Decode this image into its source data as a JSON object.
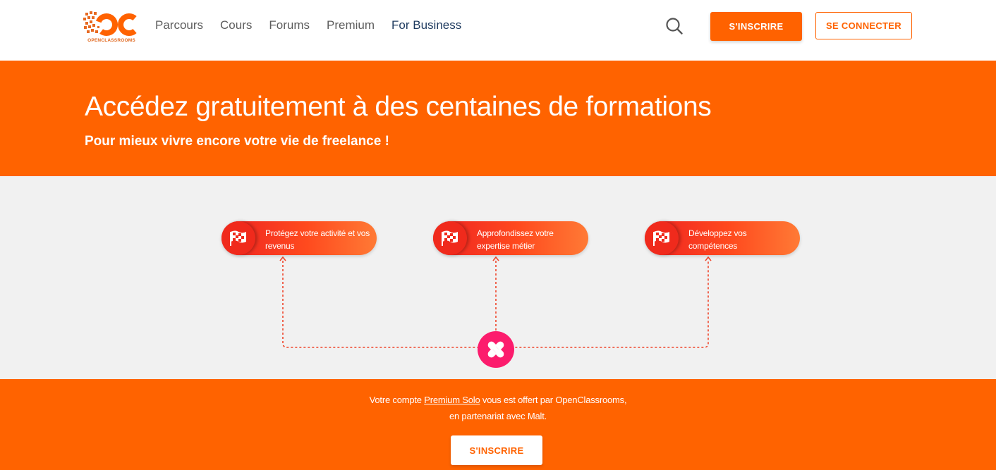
{
  "header": {
    "logo_text": "OPENCLASSROOMS",
    "nav": [
      {
        "label": "Parcours"
      },
      {
        "label": "Cours"
      },
      {
        "label": "Forums"
      },
      {
        "label": "Premium"
      },
      {
        "label": "For Business"
      }
    ],
    "search_icon": "search-icon",
    "signup_label": "S'INSCRIRE",
    "login_label": "SE CONNECTER"
  },
  "hero": {
    "title": "Accédez gratuitement à des centaines de formations",
    "subtitle": "Pour mieux vivre encore votre vie de freelance !"
  },
  "diagram": {
    "pills": [
      {
        "label": "Protégez votre activité et vos revenus",
        "icon": "checkered-flag-icon"
      },
      {
        "label": "Approfondissez votre expertise métier",
        "icon": "checkered-flag-icon"
      },
      {
        "label": "Développez vos compétences",
        "icon": "checkered-flag-icon"
      }
    ],
    "center_logo": "malt-logo-icon"
  },
  "footer": {
    "text_before": "Votre compte ",
    "link": "Premium Solo",
    "text_after": " vous est offert par OpenClassrooms,",
    "line2": "en partenariat avec Malt.",
    "button_label": "S'INSCRIRE"
  },
  "colors": {
    "brand_orange": "#ff6300",
    "pill_red": "#ee2222",
    "malt_pink": "#fc1c6d",
    "nav_business": "#1e3a5f"
  }
}
